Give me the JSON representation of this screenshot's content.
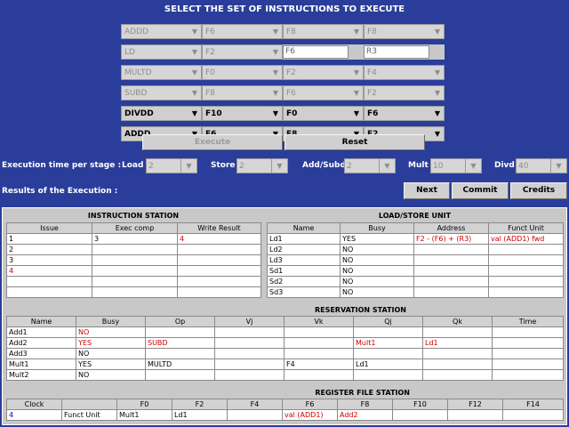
{
  "title": "SELECT THE SET OF INSTRUCTIONS TO EXECUTE",
  "instruction_rows": [
    {
      "op": "ADDD",
      "r1": "F6",
      "r2": "F8",
      "r3": "F8",
      "active": false
    },
    {
      "op": "LD",
      "r1": "F2",
      "r2": "F6",
      "r3": "R3",
      "active": false,
      "text_fields": true
    },
    {
      "op": "MULTD",
      "r1": "F0",
      "r2": "F2",
      "r3": "F4",
      "active": false
    },
    {
      "op": "SUBD",
      "r1": "F8",
      "r2": "F6",
      "r3": "F2",
      "active": false
    },
    {
      "op": "DIVDD",
      "r1": "F10",
      "r2": "F0",
      "r3": "F6",
      "active": true
    },
    {
      "op": "ADDD",
      "r1": "F6",
      "r2": "F8",
      "r3": "F2",
      "active": true
    }
  ],
  "buttons": {
    "execute": "Execute",
    "reset": "Reset",
    "next": "Next",
    "commit": "Commit",
    "credits": "Credits"
  },
  "exec_time": {
    "label": "Execution time per stage :",
    "load_label": "Load",
    "load": "2",
    "store_label": "Store",
    "store": "2",
    "addsub_label": "Add/Subd",
    "addsub": "2",
    "mult_label": "Mult",
    "mult": "10",
    "divd_label": "Divd",
    "divd": "40"
  },
  "results_label": "Results of the Execution :",
  "instruction_station": {
    "title": "INSTRUCTION STATION",
    "headers": [
      "Issue",
      "Exec comp",
      "Write Result"
    ],
    "rows": [
      [
        "1",
        "3",
        "4"
      ],
      [
        "2",
        "",
        ""
      ],
      [
        "3",
        "",
        ""
      ],
      [
        "4",
        "",
        ""
      ],
      [
        "",
        "",
        " "
      ],
      [
        "",
        "",
        ""
      ]
    ]
  },
  "load_store": {
    "title": "LOAD/STORE UNIT",
    "headers": [
      "Name",
      "Busy",
      "Address",
      "Funct Unit"
    ],
    "rows": [
      [
        "Ld1",
        "YES",
        "F2 - (F6) + (R3)",
        "val (ADD1) fwd"
      ],
      [
        "Ld2",
        "NO",
        "",
        ""
      ],
      [
        "Ld3",
        "NO",
        "",
        ""
      ],
      [
        "Sd1",
        "NO",
        "",
        ""
      ],
      [
        "Sd2",
        "NO",
        "",
        ""
      ],
      [
        "Sd3",
        "NO",
        "",
        ""
      ]
    ]
  },
  "reservation": {
    "title": "RESERVATION STATION",
    "headers": [
      "Name",
      "Busy",
      "Op",
      "Vj",
      "Vk",
      "Qj",
      "Qk",
      "Time"
    ],
    "rows": [
      [
        "Add1",
        "NO",
        "",
        "",
        "",
        "",
        "",
        ""
      ],
      [
        "Add2",
        "YES",
        "SUBD",
        "",
        "",
        "Mult1",
        "Ld1",
        ""
      ],
      [
        "Add3",
        "NO",
        "",
        "",
        "",
        "",
        "",
        ""
      ],
      [
        "Mult1",
        "YES",
        "MULTD",
        "",
        "F4",
        "Ld1",
        "",
        ""
      ],
      [
        "Mult2",
        "NO",
        "",
        "",
        "",
        "",
        "",
        ""
      ]
    ]
  },
  "register_file": {
    "title": "REGISTER FILE STATION",
    "headers": [
      "Clock",
      "",
      "F0",
      "F2",
      "F4",
      "F6",
      "F8",
      "F10",
      "F12",
      "F14"
    ],
    "row": [
      "4",
      "Funct Unit",
      "Mult1",
      "Ld1",
      "",
      "val (ADD1)",
      "Add2",
      "",
      "",
      ""
    ]
  },
  "colors": {
    "background": "#2a3d9a",
    "panel": "#c8c8c8",
    "highlight_red": "#cc0000",
    "highlight_blue": "#0000cc"
  }
}
